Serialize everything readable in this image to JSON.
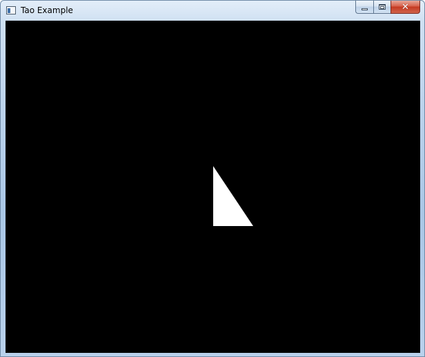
{
  "window": {
    "title": "Tao Example",
    "icon": "application-window-icon"
  },
  "caption_buttons": {
    "minimize_icon": "minimize-icon",
    "maximize_icon": "maximize-icon",
    "close_icon": "close-icon",
    "close_glyph": "✕"
  },
  "canvas": {
    "background_color": "#000000",
    "shape": {
      "type": "triangle",
      "fill_color": "#ffffff"
    }
  },
  "colors": {
    "frame_accent": "#bcd3ec",
    "close_button": "#c43a22"
  }
}
